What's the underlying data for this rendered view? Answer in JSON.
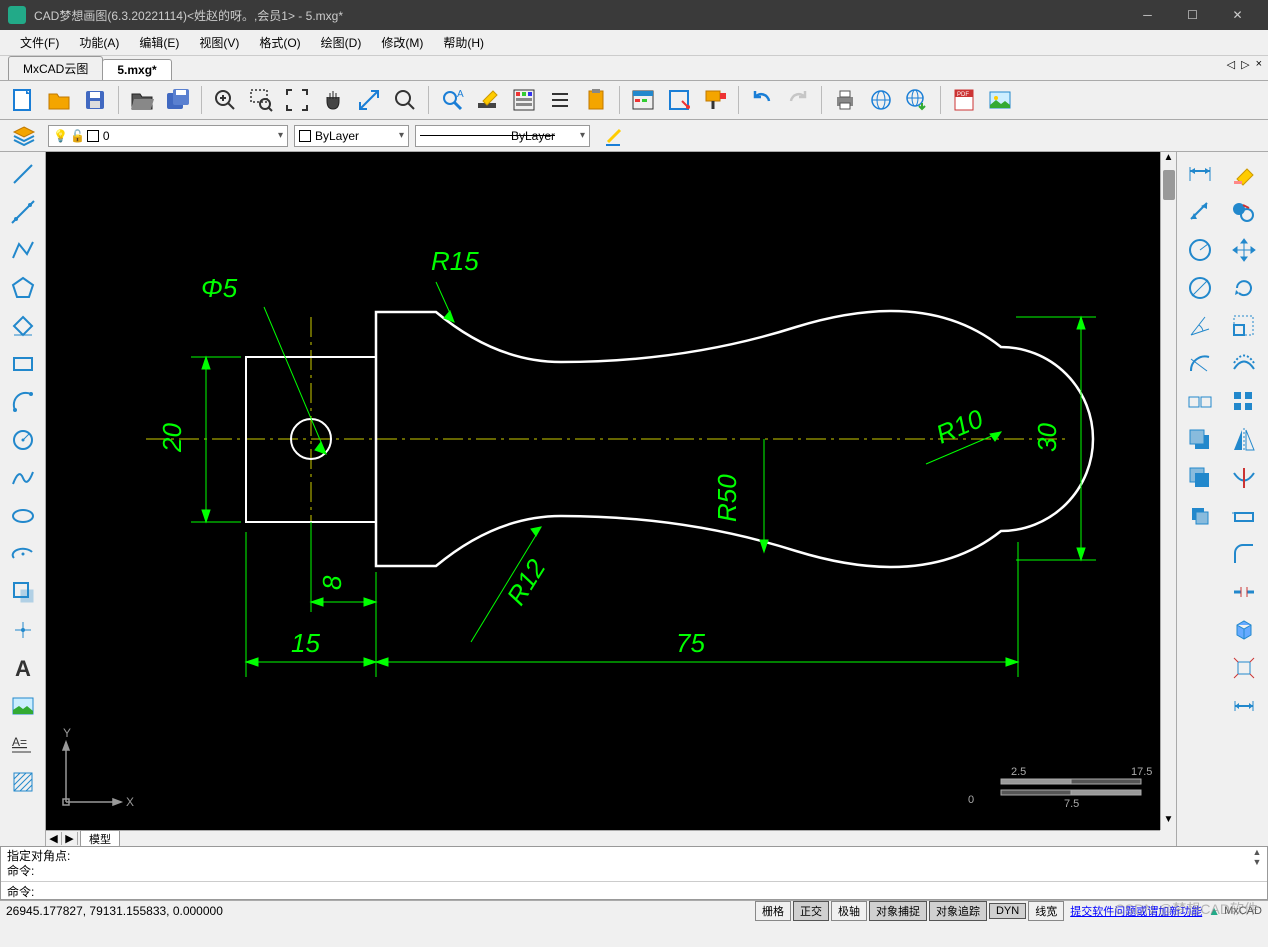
{
  "title": "CAD梦想画图(6.3.20221114)<姓赵的呀。,会员1> - 5.mxg*",
  "menu": [
    "文件(F)",
    "功能(A)",
    "编辑(E)",
    "视图(V)",
    "格式(O)",
    "绘图(D)",
    "修改(M)",
    "帮助(H)"
  ],
  "tabs": {
    "items": [
      "MxCAD云图",
      "5.mxg*"
    ],
    "active": 1
  },
  "layer": {
    "value": "0",
    "color": "ByLayer",
    "linetype": "ByLayer"
  },
  "model_tab": "模型",
  "cmd": {
    "hist1": "指定对角点:",
    "hist2": "命令:",
    "label": "命令:"
  },
  "status": {
    "coords": "26945.177827,  79131.155833,  0.000000",
    "btns": [
      "栅格",
      "正交",
      "极轴",
      "对象捕捉",
      "对象追踪",
      "DYN",
      "线宽"
    ],
    "link": "提交软件问题或谓加新功能",
    "brand": "MxCAD"
  },
  "scale": {
    "l": "2.5",
    "r": "17.5",
    "bl": "0",
    "br": "7.5"
  },
  "dims": {
    "phi": "Φ5",
    "r15": "R15",
    "r10": "R10",
    "r50": "R50",
    "r12": "R12",
    "d20": "20",
    "d30": "30",
    "d8": "8",
    "d15": "15",
    "d75": "75"
  },
  "axis": {
    "y": "Y",
    "x": "X"
  },
  "watermark": "CSDN @梦想CAD软件"
}
